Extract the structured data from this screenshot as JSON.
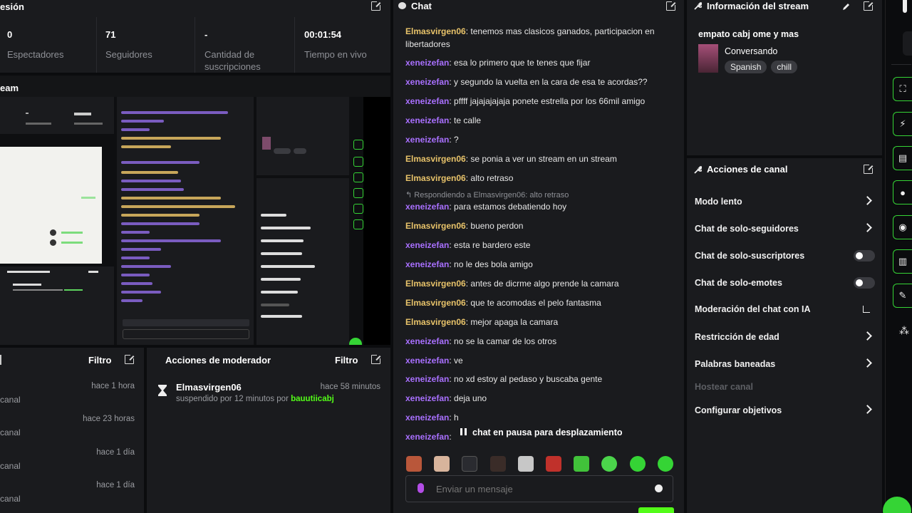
{
  "session": {
    "title": "esión",
    "stats": [
      {
        "value": "0",
        "label": "Espectadores"
      },
      {
        "value": "71",
        "label": "Seguidores"
      },
      {
        "value": "-",
        "label": "Cantidad de suscripciones"
      },
      {
        "value": "00:01:54",
        "label": "Tiempo en vivo"
      }
    ]
  },
  "stream_preview": {
    "title": "eam"
  },
  "activity": {
    "filter_label": "Filtro",
    "items": [
      {
        "time": "hace 1 hora",
        "text": "canal"
      },
      {
        "time": "hace 23 horas",
        "text": "canal"
      },
      {
        "time": "hace 1 día",
        "text": "canal"
      },
      {
        "time": "hace 1 día",
        "text": "canal"
      }
    ]
  },
  "mod_actions": {
    "title": "Acciones de moderador",
    "filter_label": "Filtro",
    "entry": {
      "user": "Elmasvirgen06",
      "time": "hace 58 minutos",
      "detail_prefix": "suspendido por 12 minutos por ",
      "moderator": "bauutiicabj"
    }
  },
  "chat": {
    "title": "Chat",
    "messages": [
      {
        "user": "Elmasvirgen06",
        "color": "#e8c36a",
        "text": "tenemos mas clasicos ganados, participacion en libertadores"
      },
      {
        "user": "xeneizefan",
        "color": "#a970ff",
        "text": "esa lo primero que te tenes que fijar"
      },
      {
        "user": "xeneizefan",
        "color": "#a970ff",
        "text": "y segundo la vuelta en la cara de esa te acordas??"
      },
      {
        "user": "xeneizefan",
        "color": "#a970ff",
        "text": "pffff jajajajajaja ponete estrella por los 66mil amigo"
      },
      {
        "user": "xeneizefan",
        "color": "#a970ff",
        "text": "te calle"
      },
      {
        "user": "xeneizefan",
        "color": "#a970ff",
        "text": "?"
      },
      {
        "user": "Elmasvirgen06",
        "color": "#e8c36a",
        "text": "se ponia a ver un stream en un stream"
      },
      {
        "user": "Elmasvirgen06",
        "color": "#e8c36a",
        "text": "alto retraso"
      },
      {
        "user": "xeneizefan",
        "color": "#a970ff",
        "text": "para estamos debatiendo hoy",
        "reply": "Respondiendo a Elmasvirgen06: alto retraso"
      },
      {
        "user": "Elmasvirgen06",
        "color": "#e8c36a",
        "text": "bueno perdon"
      },
      {
        "user": "xeneizefan",
        "color": "#a970ff",
        "text": "esta re bardero este"
      },
      {
        "user": "xeneizefan",
        "color": "#a970ff",
        "text": "no le des bola amigo"
      },
      {
        "user": "Elmasvirgen06",
        "color": "#e8c36a",
        "text": "antes de dicrme algo prende la camara"
      },
      {
        "user": "Elmasvirgen06",
        "color": "#e8c36a",
        "text": "que te acomodas el pelo fantasma"
      },
      {
        "user": "Elmasvirgen06",
        "color": "#e8c36a",
        "text": "mejor apaga la camara"
      },
      {
        "user": "xeneizefan",
        "color": "#a970ff",
        "text": "no se la camar de los otros"
      },
      {
        "user": "xeneizefan",
        "color": "#a970ff",
        "text": "ve"
      },
      {
        "user": "xeneizefan",
        "color": "#a970ff",
        "text": "no xd estoy al pedaso y buscaba gente"
      },
      {
        "user": "xeneizefan",
        "color": "#a970ff",
        "text": "deja uno"
      },
      {
        "user": "xeneizefan",
        "color": "#a970ff",
        "text": "h"
      },
      {
        "user": "xeneizefan",
        "color": "#a970ff",
        "text": ""
      }
    ],
    "paused_label": "chat en pausa para desplazamiento",
    "input_placeholder": "Enviar un mensaje"
  },
  "stream_info": {
    "title": "Información del stream",
    "stream_title": "empato cabj ome y mas",
    "category": "Conversando",
    "tags": [
      "Spanish",
      "chill"
    ]
  },
  "channel_actions": {
    "title": "Acciones de canal",
    "items": [
      {
        "label": "Modo lento",
        "control": "chevron"
      },
      {
        "label": "Chat de solo-seguidores",
        "control": "chevron"
      },
      {
        "label": "Chat de solo-suscriptores",
        "control": "toggle"
      },
      {
        "label": "Chat de solo-emotes",
        "control": "toggle"
      },
      {
        "label": "Moderación del chat con IA",
        "control": "external"
      },
      {
        "label": "Restricción de edad",
        "control": "chevron"
      },
      {
        "label": "Palabras baneadas",
        "control": "chevron"
      },
      {
        "label": "Hostear canal",
        "control": "disabled"
      },
      {
        "label": "Configurar objetivos",
        "control": "chevron"
      }
    ]
  },
  "colors": {
    "accent": "#53fc18",
    "user_yellow": "#e8c36a",
    "user_purple": "#a970ff"
  }
}
